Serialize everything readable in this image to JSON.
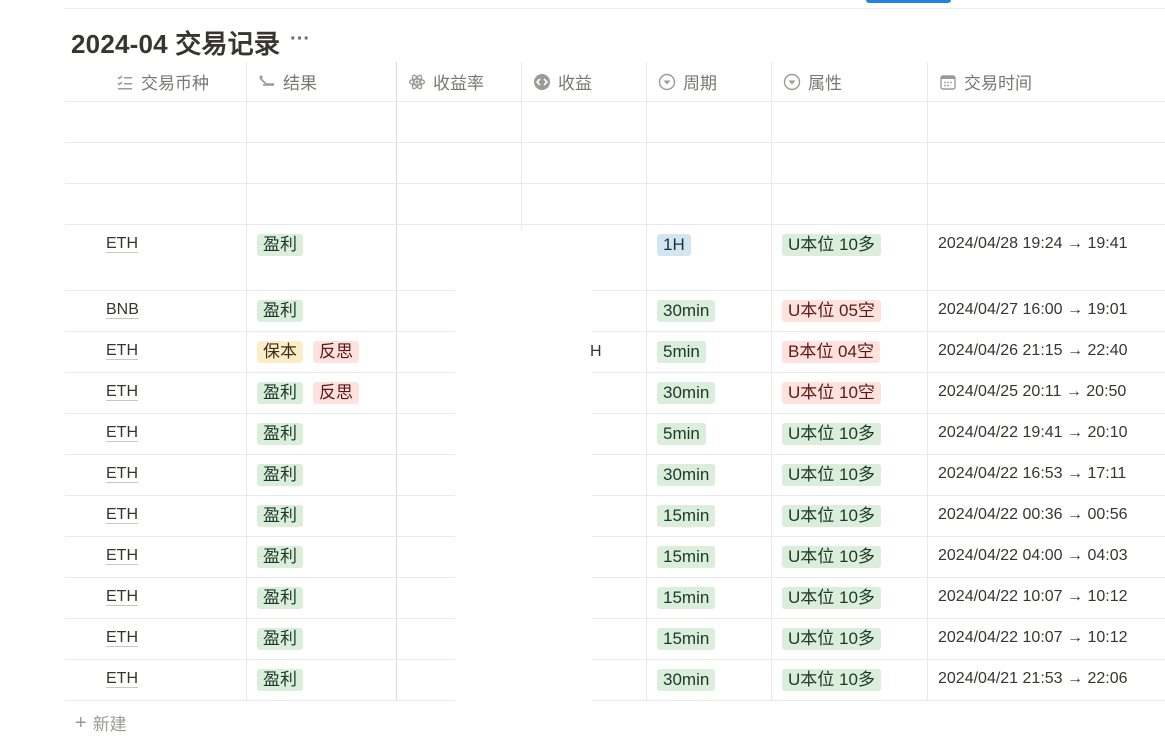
{
  "database": {
    "title": "2024-04 交易记录",
    "more_label": "···"
  },
  "columns": [
    {
      "label": "交易币种",
      "icon": "list-check-icon"
    },
    {
      "label": "结果",
      "icon": "multi-select-icon"
    },
    {
      "label": "收益率",
      "icon": "formula-icon"
    },
    {
      "label": "收益",
      "icon": "rollup-icon"
    },
    {
      "label": "周期",
      "icon": "select-icon"
    },
    {
      "label": "属性",
      "icon": "select-icon"
    },
    {
      "label": "交易时间",
      "icon": "calendar-icon"
    }
  ],
  "rows": [
    {
      "coin": "ETH",
      "results": [
        {
          "label": "盈利",
          "color": "green"
        }
      ],
      "period": {
        "label": "1H",
        "color": "blue"
      },
      "attr": {
        "label": "U本位 10多",
        "color": "green"
      },
      "time": "2024/04/28 19:24 → 19:41"
    },
    {
      "coin": "BNB",
      "results": [
        {
          "label": "盈利",
          "color": "green"
        }
      ],
      "period": {
        "label": "30min",
        "color": "green"
      },
      "attr": {
        "label": "U本位 05空",
        "color": "red"
      },
      "time": "2024/04/27 16:00 → 19:01"
    },
    {
      "coin": "ETH",
      "results": [
        {
          "label": "保本",
          "color": "yellow"
        },
        {
          "label": "反思",
          "color": "red"
        }
      ],
      "period": {
        "label": "5min",
        "color": "green"
      },
      "attr": {
        "label": "B本位 04空",
        "color": "red"
      },
      "time": "2024/04/26 21:15 → 22:40"
    },
    {
      "coin": "ETH",
      "results": [
        {
          "label": "盈利",
          "color": "green"
        },
        {
          "label": "反思",
          "color": "red"
        }
      ],
      "period": {
        "label": "30min",
        "color": "green"
      },
      "attr": {
        "label": "U本位 10空",
        "color": "red"
      },
      "time": "2024/04/25 20:11 → 20:50"
    },
    {
      "coin": "ETH",
      "results": [
        {
          "label": "盈利",
          "color": "green"
        }
      ],
      "period": {
        "label": "5min",
        "color": "green"
      },
      "attr": {
        "label": "U本位 10多",
        "color": "green"
      },
      "time": "2024/04/22 19:41 → 20:10"
    },
    {
      "coin": "ETH",
      "results": [
        {
          "label": "盈利",
          "color": "green"
        }
      ],
      "period": {
        "label": "30min",
        "color": "green"
      },
      "attr": {
        "label": "U本位 10多",
        "color": "green"
      },
      "time": "2024/04/22 16:53 → 17:11"
    },
    {
      "coin": "ETH",
      "results": [
        {
          "label": "盈利",
          "color": "green"
        }
      ],
      "period": {
        "label": "15min",
        "color": "green"
      },
      "attr": {
        "label": "U本位 10多",
        "color": "green"
      },
      "time": "2024/04/22 00:36 → 00:56"
    },
    {
      "coin": "ETH",
      "results": [
        {
          "label": "盈利",
          "color": "green"
        }
      ],
      "period": {
        "label": "15min",
        "color": "green"
      },
      "attr": {
        "label": "U本位 10多",
        "color": "green"
      },
      "time": "2024/04/22 04:00 → 04:03"
    },
    {
      "coin": "ETH",
      "results": [
        {
          "label": "盈利",
          "color": "green"
        }
      ],
      "period": {
        "label": "15min",
        "color": "green"
      },
      "attr": {
        "label": "U本位 10多",
        "color": "green"
      },
      "time": "2024/04/22 10:07 → 10:12"
    },
    {
      "coin": "ETH",
      "results": [
        {
          "label": "盈利",
          "color": "green"
        }
      ],
      "period": {
        "label": "15min",
        "color": "green"
      },
      "attr": {
        "label": "U本位 10多",
        "color": "green"
      },
      "time": "2024/04/22 10:07 → 10:12"
    },
    {
      "coin": "ETH",
      "results": [
        {
          "label": "盈利",
          "color": "green"
        }
      ],
      "period": {
        "label": "30min",
        "color": "green"
      },
      "attr": {
        "label": "U本位 10多",
        "color": "green"
      },
      "time": "2024/04/21 21:53 → 22:06"
    }
  ],
  "truncated_text": "H",
  "new_row": {
    "plus": "+",
    "label": "新建"
  }
}
